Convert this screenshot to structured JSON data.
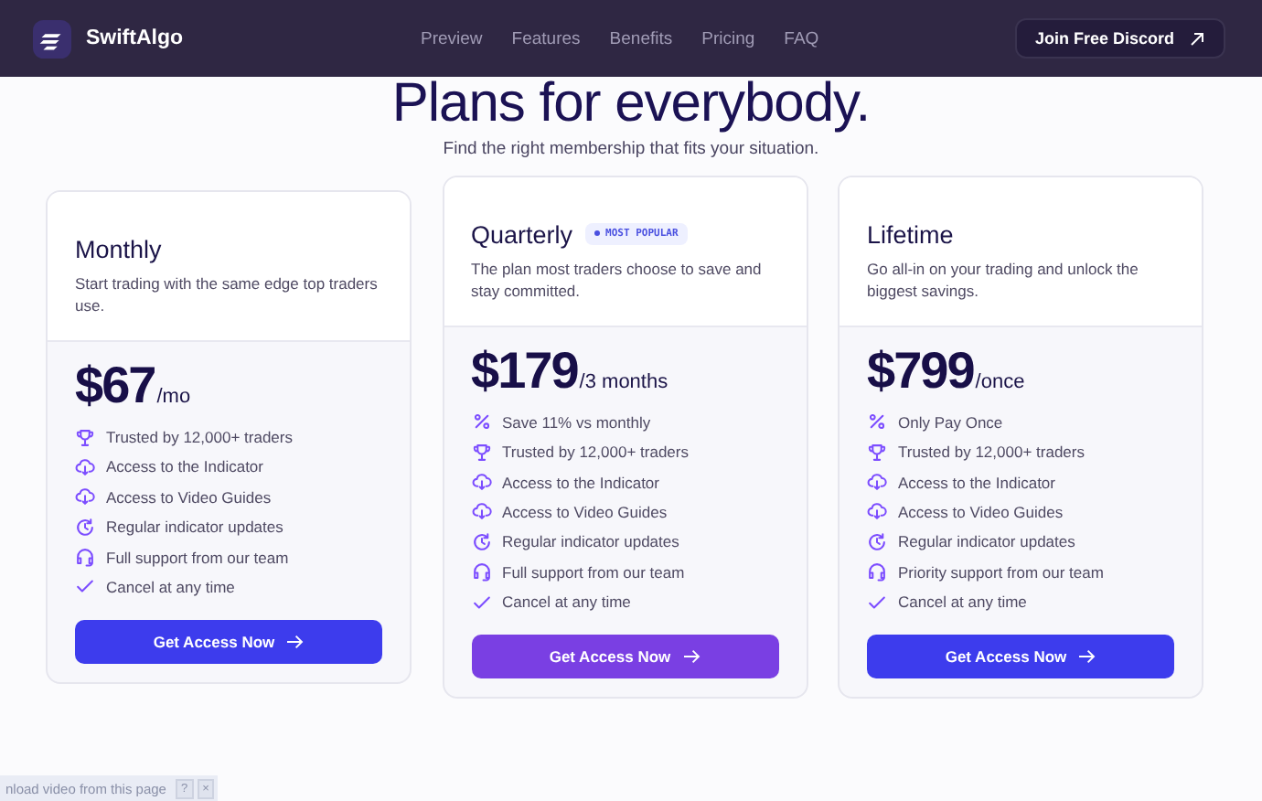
{
  "header": {
    "brand": "SwiftAlgo",
    "nav": [
      {
        "label": "Preview"
      },
      {
        "label": "Features"
      },
      {
        "label": "Benefits"
      },
      {
        "label": "Pricing"
      },
      {
        "label": "FAQ"
      }
    ],
    "cta": "Join Free Discord"
  },
  "title": "Plans for everybody.",
  "subtitle": "Find the right membership that fits your situation.",
  "plans": [
    {
      "name": "Monthly",
      "featured": false,
      "description": "Start trading with the same edge top traders use.",
      "price": "$67",
      "period": "/mo",
      "features": [
        {
          "kind": "trophy",
          "text": "Trusted by 12,000+ traders"
        },
        {
          "kind": "cloud",
          "text": "Access to the Indicator"
        },
        {
          "kind": "cloud",
          "text": "Access to Video Guides"
        },
        {
          "kind": "update",
          "text": "Regular indicator updates"
        },
        {
          "kind": "headset",
          "text": "Full support from our team"
        },
        {
          "kind": "check",
          "text": "Cancel at any time"
        }
      ],
      "button": "Get Access Now"
    },
    {
      "name": "Quarterly",
      "featured": true,
      "badge": "MOST POPULAR",
      "description": "The plan most traders choose to save and stay committed.",
      "price": "$179",
      "period": "/3 months",
      "features": [
        {
          "kind": "percent",
          "text": "Save 11% vs monthly"
        },
        {
          "kind": "trophy",
          "text": "Trusted by 12,000+ traders"
        },
        {
          "kind": "cloud",
          "text": "Access to the Indicator"
        },
        {
          "kind": "cloud",
          "text": "Access to Video Guides"
        },
        {
          "kind": "update",
          "text": "Regular indicator updates"
        },
        {
          "kind": "headset",
          "text": "Full support from our team"
        },
        {
          "kind": "check",
          "text": "Cancel at any time"
        }
      ],
      "button": "Get Access Now"
    },
    {
      "name": "Lifetime",
      "featured": false,
      "description": "Go all-in on your trading and unlock the biggest savings.",
      "price": "$799",
      "period": "/once",
      "features": [
        {
          "kind": "percent",
          "text": "Only Pay Once"
        },
        {
          "kind": "trophy",
          "text": "Trusted by 12,000+ traders"
        },
        {
          "kind": "cloud",
          "text": "Access to the Indicator"
        },
        {
          "kind": "cloud",
          "text": "Access to Video Guides"
        },
        {
          "kind": "update",
          "text": "Regular indicator updates"
        },
        {
          "kind": "headset",
          "text": "Priority support from our team"
        },
        {
          "kind": "check",
          "text": "Cancel at any time"
        }
      ],
      "button": "Get Access Now"
    }
  ],
  "extension_bar": {
    "text": "nload video from this page",
    "buttons": [
      "?",
      "×"
    ]
  }
}
